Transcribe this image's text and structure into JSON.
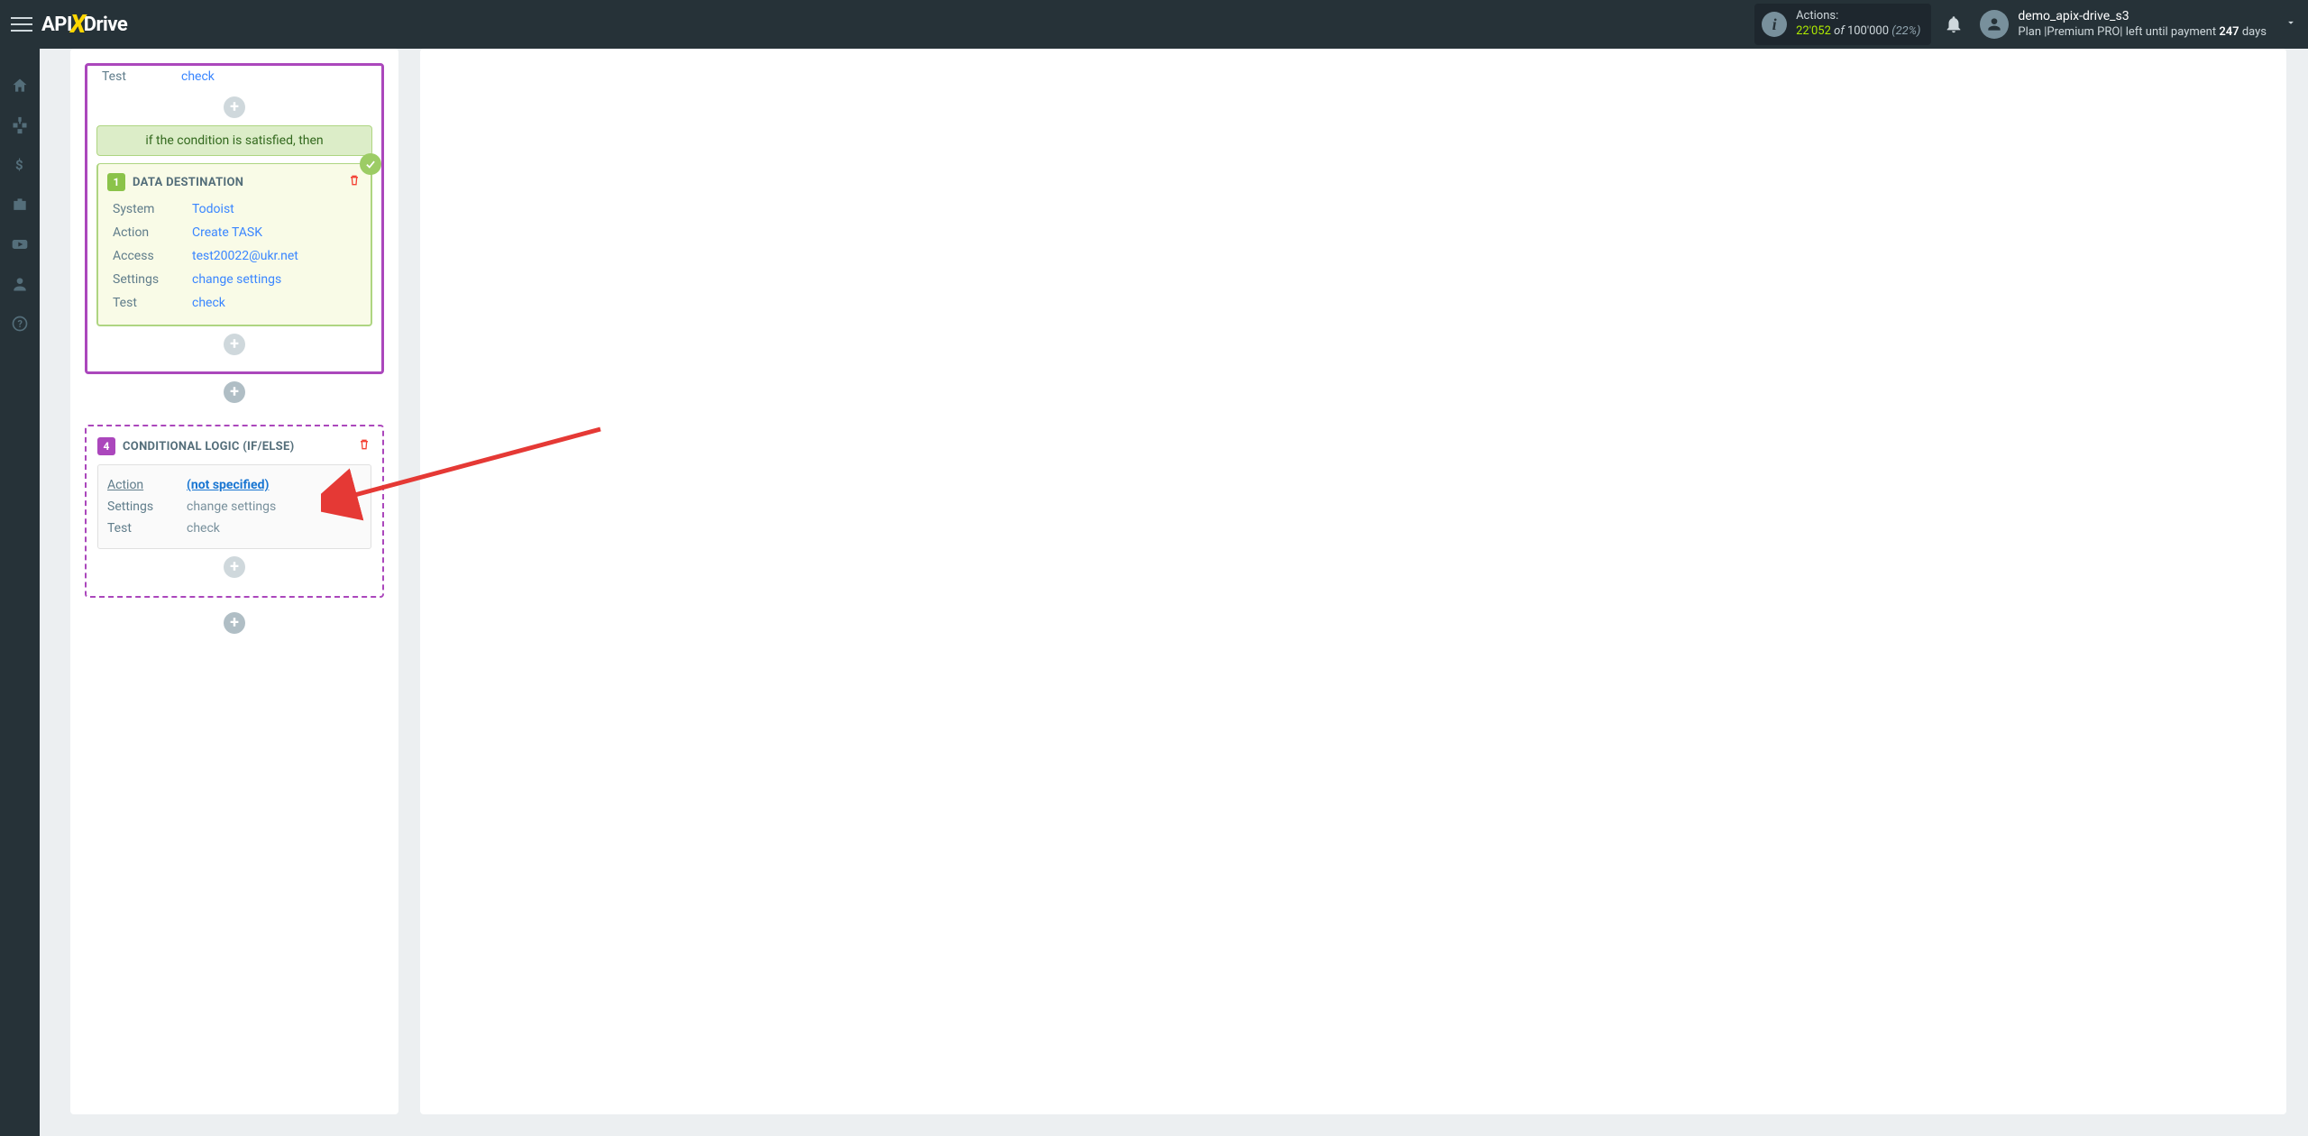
{
  "header": {
    "logo_api": "API",
    "logo_x": "X",
    "logo_drive": "Drive",
    "actions_label": "Actions:",
    "actions_count": "22'052",
    "actions_of": "of",
    "actions_total": "100'000",
    "actions_pct": "(22%)",
    "username": "demo_apix-drive_s3",
    "plan_prefix": "Plan ",
    "plan_name": "|Premium PRO|",
    "plan_mid": " left until payment ",
    "plan_days": "247",
    "plan_suffix": " days"
  },
  "filter": {
    "test_label": "Test",
    "test_value": "check",
    "condition_banner": "if the condition is satisfied, then"
  },
  "destination": {
    "badge": "1",
    "title": "DATA DESTINATION",
    "rows": {
      "system_label": "System",
      "system_value": "Todoist",
      "action_label": "Action",
      "action_value": "Create TASK",
      "access_label": "Access",
      "access_value": "test20022@ukr.net",
      "settings_label": "Settings",
      "settings_value": "change settings",
      "test_label": "Test",
      "test_value": "check"
    }
  },
  "logic": {
    "badge": "4",
    "title": "CONDITIONAL LOGIC (IF/ELSE)",
    "rows": {
      "action_label": "Action",
      "action_value": "(not specified)",
      "settings_label": "Settings",
      "settings_value": "change settings",
      "test_label": "Test",
      "test_value": "check"
    }
  },
  "icons": {
    "plus": "+"
  }
}
